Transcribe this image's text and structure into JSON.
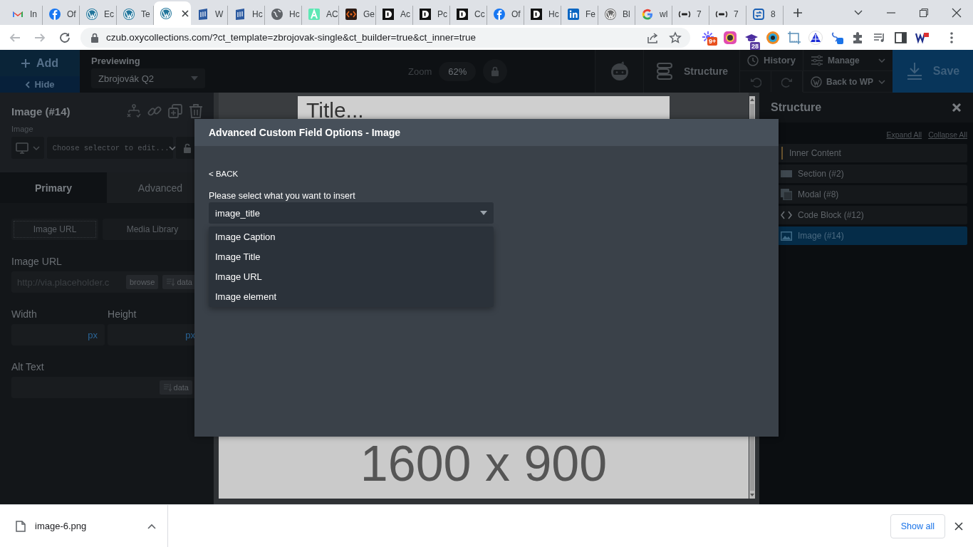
{
  "browser": {
    "tabs": [
      {
        "kind": "mail",
        "label": "In",
        "selected": false
      },
      {
        "kind": "facebook",
        "label": "Of",
        "selected": false
      },
      {
        "kind": "wordpress",
        "label": "Ec",
        "selected": false
      },
      {
        "kind": "wordpress",
        "label": "Te",
        "selected": false
      },
      {
        "kind": "wordpress",
        "selected": true
      },
      {
        "kind": "book",
        "label": "W",
        "selected": false
      },
      {
        "kind": "book",
        "label": "Hc",
        "selected": false
      },
      {
        "kind": "globe",
        "label": "Hc",
        "selected": false
      },
      {
        "kind": "acf",
        "label": "AC",
        "selected": false
      },
      {
        "kind": "code",
        "label": "Ge",
        "selected": false
      },
      {
        "kind": "d",
        "label": "Ac",
        "selected": false
      },
      {
        "kind": "d",
        "label": "Pc",
        "selected": false
      },
      {
        "kind": "d",
        "label": "Cc",
        "selected": false
      },
      {
        "kind": "facebook",
        "label": "Of",
        "selected": false
      },
      {
        "kind": "d",
        "label": "Hc",
        "selected": false
      },
      {
        "kind": "linkedin",
        "label": "Fe",
        "selected": false
      },
      {
        "kind": "wordpress-grey",
        "label": "Bl",
        "selected": false
      },
      {
        "kind": "google",
        "label": "wl",
        "selected": false
      },
      {
        "kind": "rmt",
        "label": "7",
        "selected": false
      },
      {
        "kind": "rmt",
        "label": "7",
        "selected": false
      },
      {
        "kind": "sync",
        "label": "8",
        "selected": false
      }
    ],
    "url": "czub.oxycollections.com/?ct_template=zbrojovak-single&ct_builder=true&ct_inner=true",
    "extensions": [
      {
        "kind": "spark",
        "badge": "9+"
      },
      {
        "kind": "ring"
      },
      {
        "kind": "cap",
        "badge": "28"
      },
      {
        "kind": "eye"
      },
      {
        "kind": "ruler"
      },
      {
        "kind": "triangle"
      },
      {
        "kind": "link"
      },
      {
        "kind": "puzzle"
      },
      {
        "kind": "media"
      },
      {
        "kind": "sidepanel"
      },
      {
        "kind": "wp"
      }
    ]
  },
  "builder_toolbar": {
    "add": "Add",
    "hide": "Hide",
    "previewing_label": "Previewing",
    "preview_value": "Zbrojovák Q2",
    "zoom_label": "Zoom",
    "zoom_value": "62%",
    "structure": "Structure",
    "history": "History",
    "manage": "Manage",
    "back_to_wp": "Back to WP",
    "save": "Save"
  },
  "left_panel": {
    "title": "Image (#14)",
    "subtitle": "Image",
    "selector_placeholder": "Choose selector to edit...",
    "tabs": [
      {
        "label": "Primary",
        "selected": true
      },
      {
        "label": "Advanced",
        "selected": false
      }
    ],
    "sources": [
      {
        "label": "Image URL",
        "selected": true
      },
      {
        "label": "Media Library",
        "selected": false
      }
    ],
    "image_url": {
      "label": "Image URL",
      "placeholder": "http://via.placeholder.c",
      "browse": "browse",
      "data": "data"
    },
    "width": {
      "label": "Width",
      "unit": "px"
    },
    "height": {
      "label": "Height",
      "unit": "px"
    },
    "alt_text": {
      "label": "Alt Text",
      "data": "data"
    }
  },
  "canvas": {
    "title": "Title...",
    "image_placeholder": "1600 x 900"
  },
  "modal": {
    "title": "Advanced Custom Field Options - Image",
    "back": "< BACK",
    "prompt": "Please select what you want to insert",
    "select_value": "image_title",
    "options": [
      {
        "label": "Image Caption",
        "selected": false
      },
      {
        "label": "Image Title",
        "selected": false
      },
      {
        "label": "Image URL",
        "selected": false
      },
      {
        "label": "Image element",
        "selected": false
      }
    ]
  },
  "structure_panel": {
    "title": "Structure",
    "expand_all": "Expand All",
    "collapse_all": "Collapse All",
    "items": [
      {
        "kind": "inner",
        "label": "Inner Content",
        "selected": false,
        "children": [
          {
            "kind": "section",
            "label": "Section (#2)",
            "selected": false
          },
          {
            "kind": "modal",
            "label": "Modal (#8)",
            "selected": false
          },
          {
            "kind": "code",
            "label": "Code Block (#12)",
            "selected": false
          },
          {
            "kind": "image",
            "label": "Image (#14)",
            "selected": true
          }
        ]
      }
    ]
  },
  "download_bar": {
    "file": "image-6.png",
    "show_all": "Show all"
  }
}
